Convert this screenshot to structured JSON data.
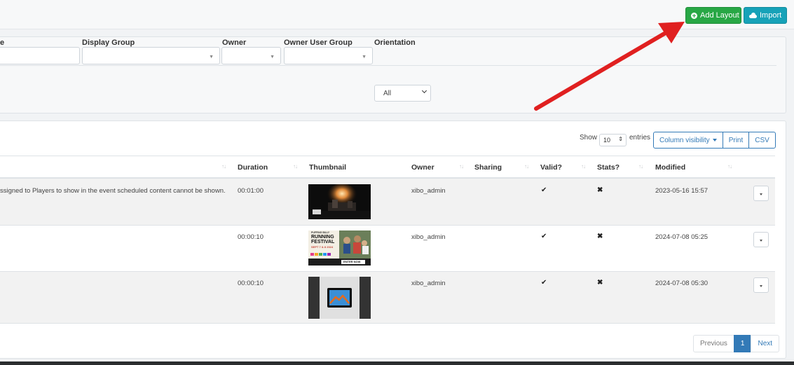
{
  "header": {
    "add_layout_label": "Add Layout",
    "import_label": "Import",
    "add_color": "#28a745",
    "import_color": "#17a2b8"
  },
  "filters": {
    "name_label_fragment": "e",
    "display_group_label": "Display Group",
    "owner_label": "Owner",
    "owner_user_group_label": "Owner User Group",
    "orientation_label": "Orientation",
    "orientation_value": "All"
  },
  "table_controls": {
    "show_label": "Show",
    "page_length": "10",
    "entries_label": "entries",
    "column_visibility_label": "Column visibility",
    "print_label": "Print",
    "csv_label": "CSV"
  },
  "columns": {
    "duration": "Duration",
    "thumbnail": "Thumbnail",
    "owner": "Owner",
    "sharing": "Sharing",
    "valid": "Valid?",
    "stats": "Stats?",
    "modified": "Modified"
  },
  "rows": [
    {
      "description_fragment": "ssigned to Players to show in the event scheduled content cannot be shown.",
      "duration": "00:01:00",
      "thumbnail_icon": "concert-photo-thumbnail",
      "owner": "xibo_admin",
      "sharing": "",
      "valid": "✔",
      "stats": "✖",
      "modified": "2023-05-16 15:57"
    },
    {
      "description_fragment": "",
      "duration": "00:00:10",
      "thumbnail_icon": "festival-poster-thumbnail",
      "thumbnail_text": [
        "PUFFING BILLY",
        "RUNNING",
        "FESTIVAL",
        "SEPT 7 & 8 2024",
        "ENTER NOW"
      ],
      "owner": "xibo_admin",
      "sharing": "",
      "valid": "✔",
      "stats": "✖",
      "modified": "2024-07-08 05:25"
    },
    {
      "description_fragment": "",
      "duration": "00:00:10",
      "thumbnail_icon": "image-placeholder-thumbnail",
      "owner": "xibo_admin",
      "sharing": "",
      "valid": "✔",
      "stats": "✖",
      "modified": "2024-07-08 05:30"
    }
  ],
  "pagination": {
    "previous_label": "Previous",
    "current_page": "1",
    "next_label": "Next"
  },
  "annotation": {
    "arrow_icon": "red-arrow-annotation",
    "arrow_color": "#e02020"
  }
}
